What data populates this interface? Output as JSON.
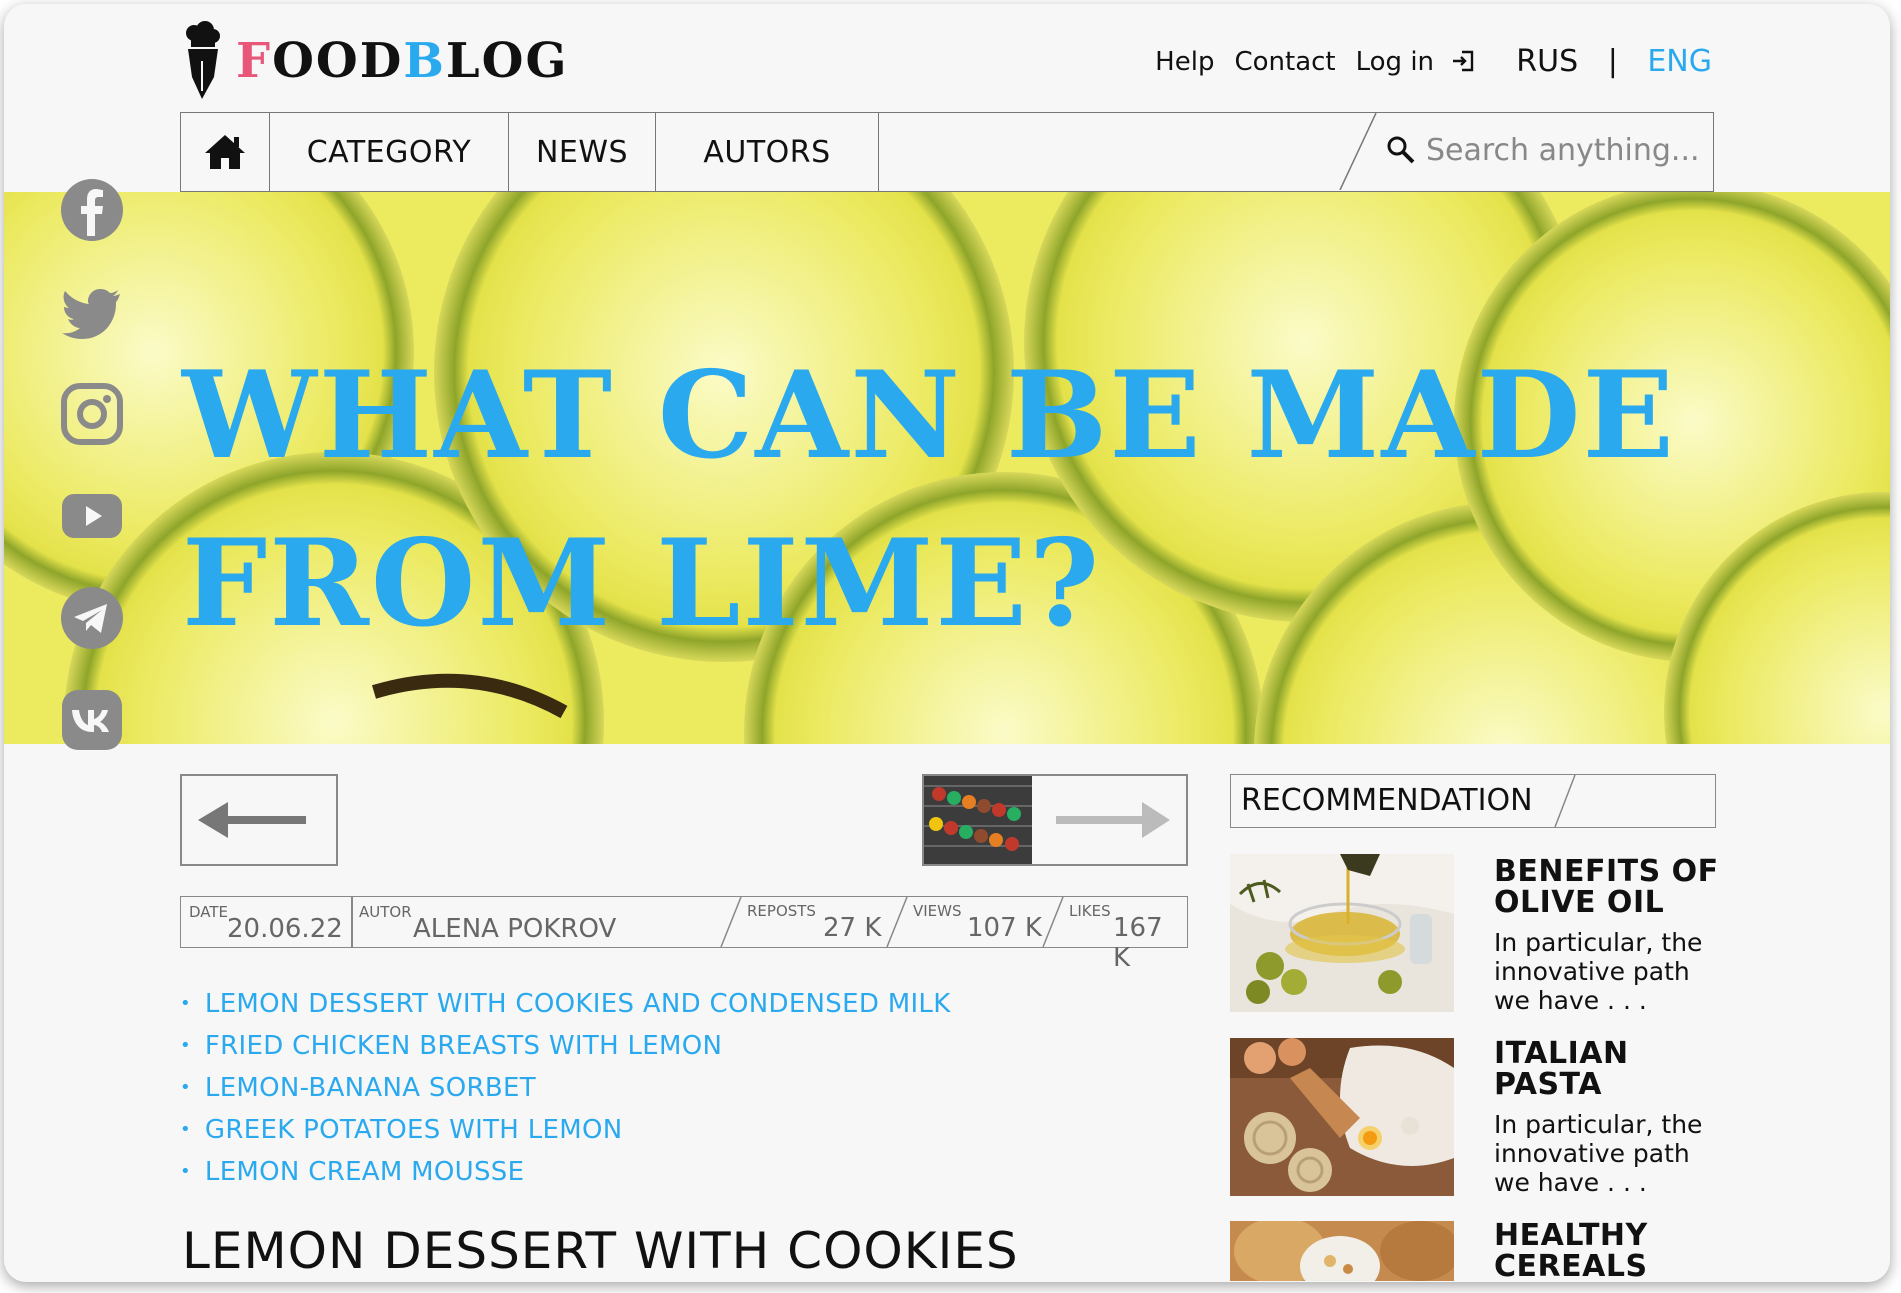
{
  "header": {
    "logo": {
      "part1": "F",
      "part2": "OOD",
      "part3": "B",
      "part4": "LOG"
    },
    "links": {
      "help": "Help",
      "contact": "Contact",
      "login": "Log in"
    },
    "lang": {
      "rus": "RUS",
      "sep": "|",
      "eng": "ENG"
    }
  },
  "nav": {
    "category": "CATEGORY",
    "news": "NEWS",
    "autors": "AUTORS",
    "search_placeholder": "Search anything..."
  },
  "hero": {
    "line1": "WHAT CAN BE MADE",
    "line2": "FROM LIME?"
  },
  "social": [
    "facebook-icon",
    "twitter-icon",
    "instagram-icon",
    "youtube-icon",
    "telegram-icon",
    "vk-icon"
  ],
  "meta": {
    "date_label": "DATE",
    "date": "20.06.22",
    "autor_label": "AUTOR",
    "autor": "ALENA POKROV",
    "reposts_label": "REPOSTS",
    "reposts": "27 K",
    "views_label": "VIEWS",
    "views": "107 K",
    "likes_label": "LIKES",
    "likes": "167 K"
  },
  "recipes": [
    "LEMON DESSERT WITH COOKIES AND CONDENSED MILK",
    "FRIED CHICKEN BREASTS WITH LEMON",
    "LEMON-BANANA SORBET",
    "GREEK POTATOES WITH LEMON",
    "LEMON CREAM MOUSSE"
  ],
  "article_title": "LEMON DESSERT WITH COOKIES",
  "recommendation": {
    "heading": "RECOMMENDATION",
    "items": [
      {
        "title1": "BENEFITS OF",
        "title2": "OLIVE OIL",
        "d1": "In particular, the",
        "d2": "innovative path",
        "d3": "we have . . ."
      },
      {
        "title1": "ITALIAN",
        "title2": "PASTA",
        "d1": "In particular, the",
        "d2": "innovative path",
        "d3": "we have . . ."
      },
      {
        "title1": "HEALTHY",
        "title2": "CEREALS"
      }
    ]
  },
  "colors": {
    "accent": "#2aa9ef",
    "logo_pink": "#e8577a",
    "hero_bg": "#ece95d",
    "social_gray": "#8a8a8a"
  }
}
